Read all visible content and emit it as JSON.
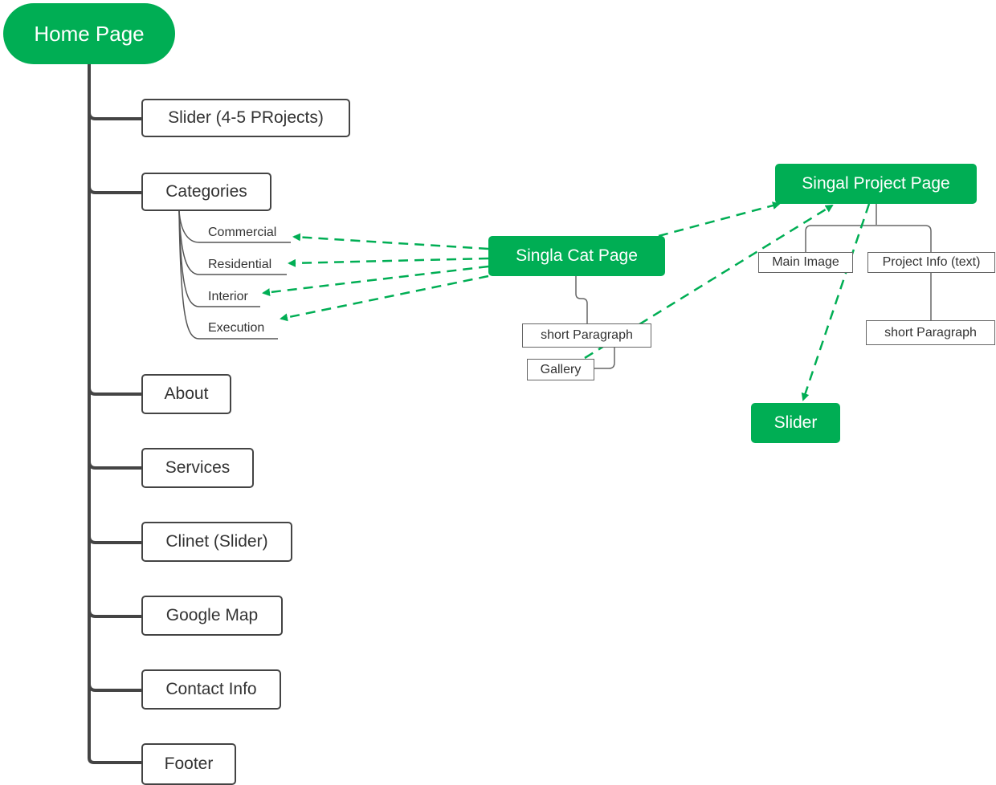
{
  "colors": {
    "accent": "#00ae54",
    "trunk": "#444444",
    "connector": "#666666"
  },
  "root": {
    "label": "Home Page"
  },
  "home_children": [
    {
      "label": "Slider (4-5 PRojects)"
    },
    {
      "label": "Categories"
    },
    {
      "label": "About"
    },
    {
      "label": "Services"
    },
    {
      "label": "Clinet (Slider)"
    },
    {
      "label": "Google Map"
    },
    {
      "label": "Contact Info"
    },
    {
      "label": "Footer"
    }
  ],
  "categories": [
    {
      "label": "Commercial"
    },
    {
      "label": "Residential"
    },
    {
      "label": "Interior"
    },
    {
      "label": "Execution"
    }
  ],
  "cat_page": {
    "label": "Singla Cat Page",
    "children": [
      {
        "label": "short Paragraph"
      },
      {
        "label": "Gallery"
      }
    ]
  },
  "project_page": {
    "label": "Singal Project Page",
    "children": [
      {
        "label": "Main Image"
      },
      {
        "label": "Project Info (text)"
      }
    ],
    "project_info_child": {
      "label": "short Paragraph"
    }
  },
  "slider_node": {
    "label": "Slider"
  },
  "relationships": [
    {
      "from": "Singla Cat Page",
      "to": "Commercial"
    },
    {
      "from": "Singla Cat Page",
      "to": "Residential"
    },
    {
      "from": "Singla Cat Page",
      "to": "Interior"
    },
    {
      "from": "Singla Cat Page",
      "to": "Execution"
    },
    {
      "from": "Singla Cat Page",
      "to": "Singal Project Page"
    },
    {
      "from": "Gallery",
      "to": "Singal Project Page"
    },
    {
      "from": "Singal Project Page",
      "to": "Slider"
    }
  ]
}
